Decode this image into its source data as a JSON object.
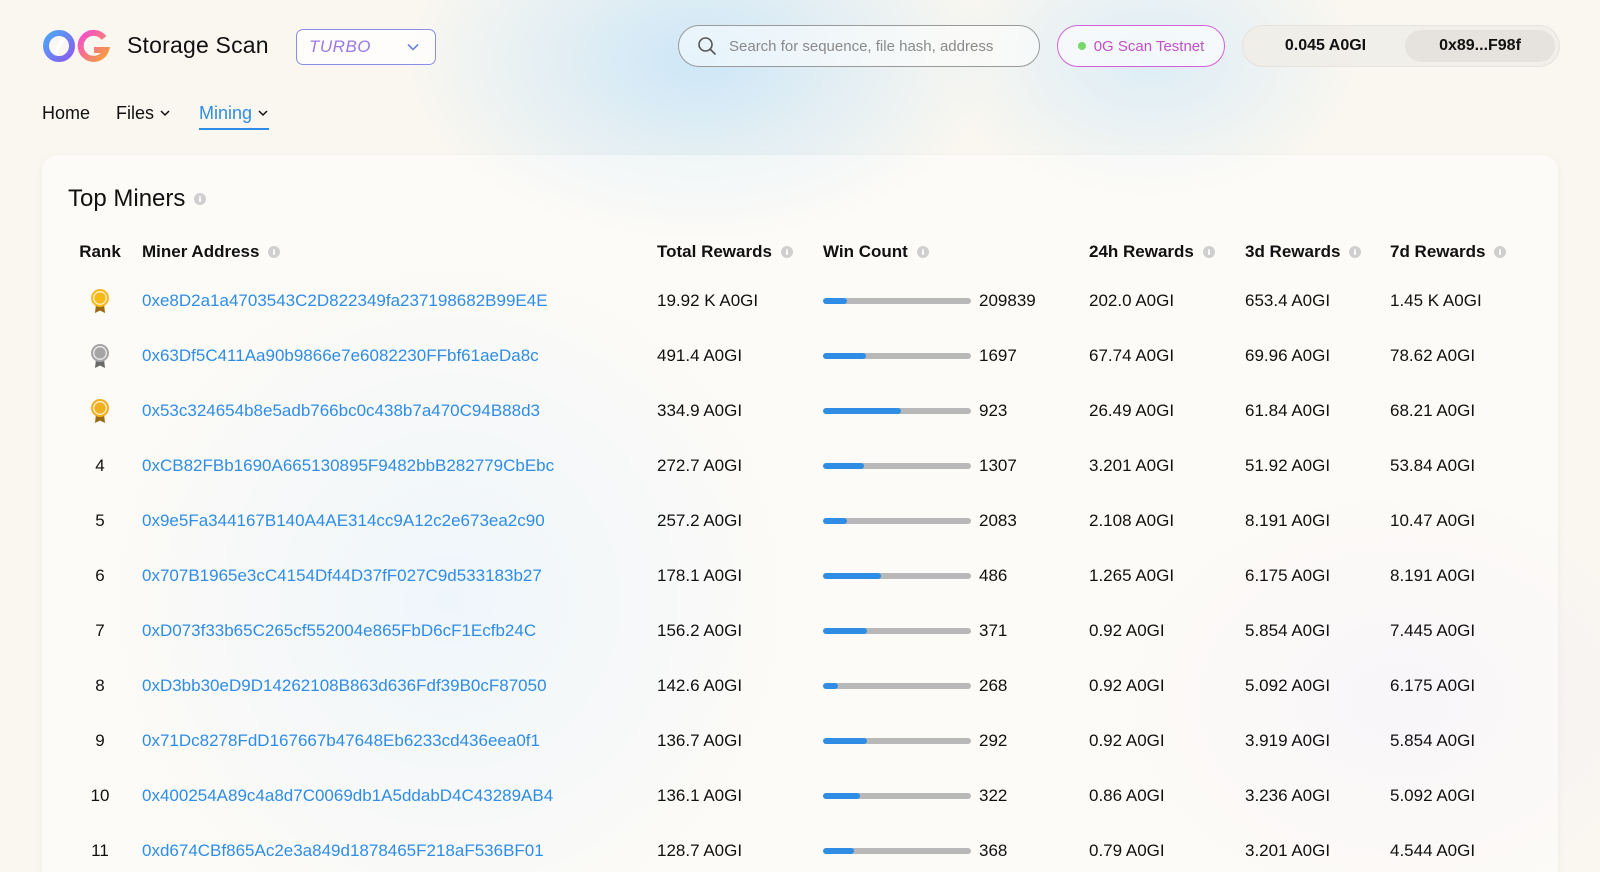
{
  "app": {
    "title": "Storage Scan",
    "network_value": "TURBO"
  },
  "search": {
    "placeholder": "Search for sequence, file hash, address"
  },
  "testnet": {
    "label": "0G Scan Testnet"
  },
  "wallet": {
    "balance": "0.045 A0GI",
    "address": "0x89...F98f"
  },
  "nav": [
    {
      "label": "Home",
      "active": false,
      "dropdown": false
    },
    {
      "label": "Files",
      "active": false,
      "dropdown": true
    },
    {
      "label": "Mining",
      "active": true,
      "dropdown": true
    }
  ],
  "card": {
    "title": "Top Miners",
    "columns": {
      "rank": "Rank",
      "address": "Miner Address",
      "total": "Total Rewards",
      "win": "Win Count",
      "r24": "24h Rewards",
      "r3d": "3d Rewards",
      "r7d": "7d Rewards"
    },
    "rows": [
      {
        "rank": "1",
        "medal": "gold",
        "address": "0xe8D2a1a4703543C2D822349fa237198682B99E4E",
        "total": "19.92 K A0GI",
        "win_fill": 0.16,
        "win": "209839",
        "r24": "202.0 A0GI",
        "r3d": "653.4 A0GI",
        "r7d": "1.45 K A0GI"
      },
      {
        "rank": "2",
        "medal": "silver",
        "address": "0x63Df5C411Aa90b9866e7e6082230FFbf61aeDa8c",
        "total": "491.4 A0GI",
        "win_fill": 0.29,
        "win": "1697",
        "r24": "67.74 A0GI",
        "r3d": "69.96 A0GI",
        "r7d": "78.62 A0GI"
      },
      {
        "rank": "3",
        "medal": "bronze",
        "address": "0x53c324654b8e5adb766bc0c438b7a470C94B88d3",
        "total": "334.9 A0GI",
        "win_fill": 0.53,
        "win": "923",
        "r24": "26.49 A0GI",
        "r3d": "61.84 A0GI",
        "r7d": "68.21 A0GI"
      },
      {
        "rank": "4",
        "medal": "",
        "address": "0xCB82FBb1690A665130895F9482bbB282779CbEbc",
        "total": "272.7 A0GI",
        "win_fill": 0.28,
        "win": "1307",
        "r24": "3.201 A0GI",
        "r3d": "51.92 A0GI",
        "r7d": "53.84 A0GI"
      },
      {
        "rank": "5",
        "medal": "",
        "address": "0x9e5Fa344167B140A4AE314cc9A12c2e673ea2c90",
        "total": "257.2 A0GI",
        "win_fill": 0.16,
        "win": "2083",
        "r24": "2.108 A0GI",
        "r3d": "8.191 A0GI",
        "r7d": "10.47 A0GI"
      },
      {
        "rank": "6",
        "medal": "",
        "address": "0x707B1965e3cC4154Df44D37fF027C9d533183b27",
        "total": "178.1 A0GI",
        "win_fill": 0.39,
        "win": "486",
        "r24": "1.265 A0GI",
        "r3d": "6.175 A0GI",
        "r7d": "8.191 A0GI"
      },
      {
        "rank": "7",
        "medal": "",
        "address": "0xD073f33b65C265cf552004e865FbD6cF1Ecfb24C",
        "total": "156.2 A0GI",
        "win_fill": 0.3,
        "win": "371",
        "r24": "0.92 A0GI",
        "r3d": "5.854 A0GI",
        "r7d": "7.445 A0GI"
      },
      {
        "rank": "8",
        "medal": "",
        "address": "0xD3bb30eD9D14262108B863d636Fdf39B0cF87050",
        "total": "142.6 A0GI",
        "win_fill": 0.1,
        "win": "268",
        "r24": "0.92 A0GI",
        "r3d": "5.092 A0GI",
        "r7d": "6.175 A0GI"
      },
      {
        "rank": "9",
        "medal": "",
        "address": "0x71Dc8278FdD167667b47648Eb6233cd436eea0f1",
        "total": "136.7 A0GI",
        "win_fill": 0.3,
        "win": "292",
        "r24": "0.92 A0GI",
        "r3d": "3.919 A0GI",
        "r7d": "5.854 A0GI"
      },
      {
        "rank": "10",
        "medal": "",
        "address": "0x400254A89c4a8d7C0069db1A5ddabD4C43289AB4",
        "total": "136.1 A0GI",
        "win_fill": 0.25,
        "win": "322",
        "r24": "0.86 A0GI",
        "r3d": "3.236 A0GI",
        "r7d": "5.092 A0GI"
      },
      {
        "rank": "11",
        "medal": "",
        "address": "0xd674CBf865Ac2e3a849d1878465F218aF536BF01",
        "total": "128.7 A0GI",
        "win_fill": 0.21,
        "win": "368",
        "r24": "0.79 A0GI",
        "r3d": "3.201 A0GI",
        "r7d": "4.544 A0GI"
      }
    ]
  },
  "colors": {
    "accent": "#2f8de6",
    "testnet": "#c150c6",
    "network": "#9a78e6",
    "gold": "#f5b91a",
    "silver": "#9c9c9c"
  },
  "icons": {
    "logo": "og-logo-icon",
    "search": "search-icon",
    "chevron": "chevron-down-icon",
    "info": "info-icon",
    "medal": "medal-icon"
  }
}
